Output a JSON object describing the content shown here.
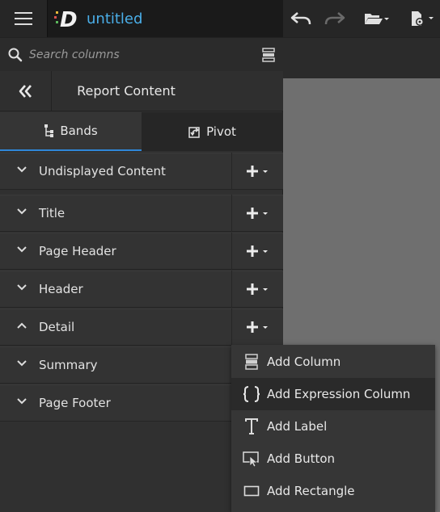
{
  "header": {
    "doc_title": "untitled",
    "logo_letter": "D",
    "accent": "#4aaee8"
  },
  "search": {
    "placeholder": "Search columns"
  },
  "panel": {
    "title": "Report Content",
    "tabs": [
      {
        "label": "Bands",
        "icon": "bands-icon",
        "active": true
      },
      {
        "label": "Pivot",
        "icon": "pivot-icon",
        "active": false
      }
    ]
  },
  "bands": [
    {
      "label": "Undisplayed Content",
      "expanded": false
    },
    {
      "label": "Title",
      "expanded": false
    },
    {
      "label": "Page Header",
      "expanded": false
    },
    {
      "label": "Header",
      "expanded": false
    },
    {
      "label": "Detail",
      "expanded": true
    },
    {
      "label": "Summary",
      "expanded": false
    },
    {
      "label": "Page Footer",
      "expanded": false
    }
  ],
  "add_menu": {
    "items": [
      {
        "label": "Add Column",
        "icon": "column-icon"
      },
      {
        "label": "Add Expression Column",
        "icon": "braces-icon"
      },
      {
        "label": "Add Label",
        "icon": "text-icon"
      },
      {
        "label": "Add Button",
        "icon": "button-cursor-icon"
      },
      {
        "label": "Add Rectangle",
        "icon": "rectangle-icon"
      }
    ],
    "highlighted_index": 1
  },
  "colors": {
    "tab_underline": "#2f87d8",
    "canvas": "#6f6f6f"
  }
}
